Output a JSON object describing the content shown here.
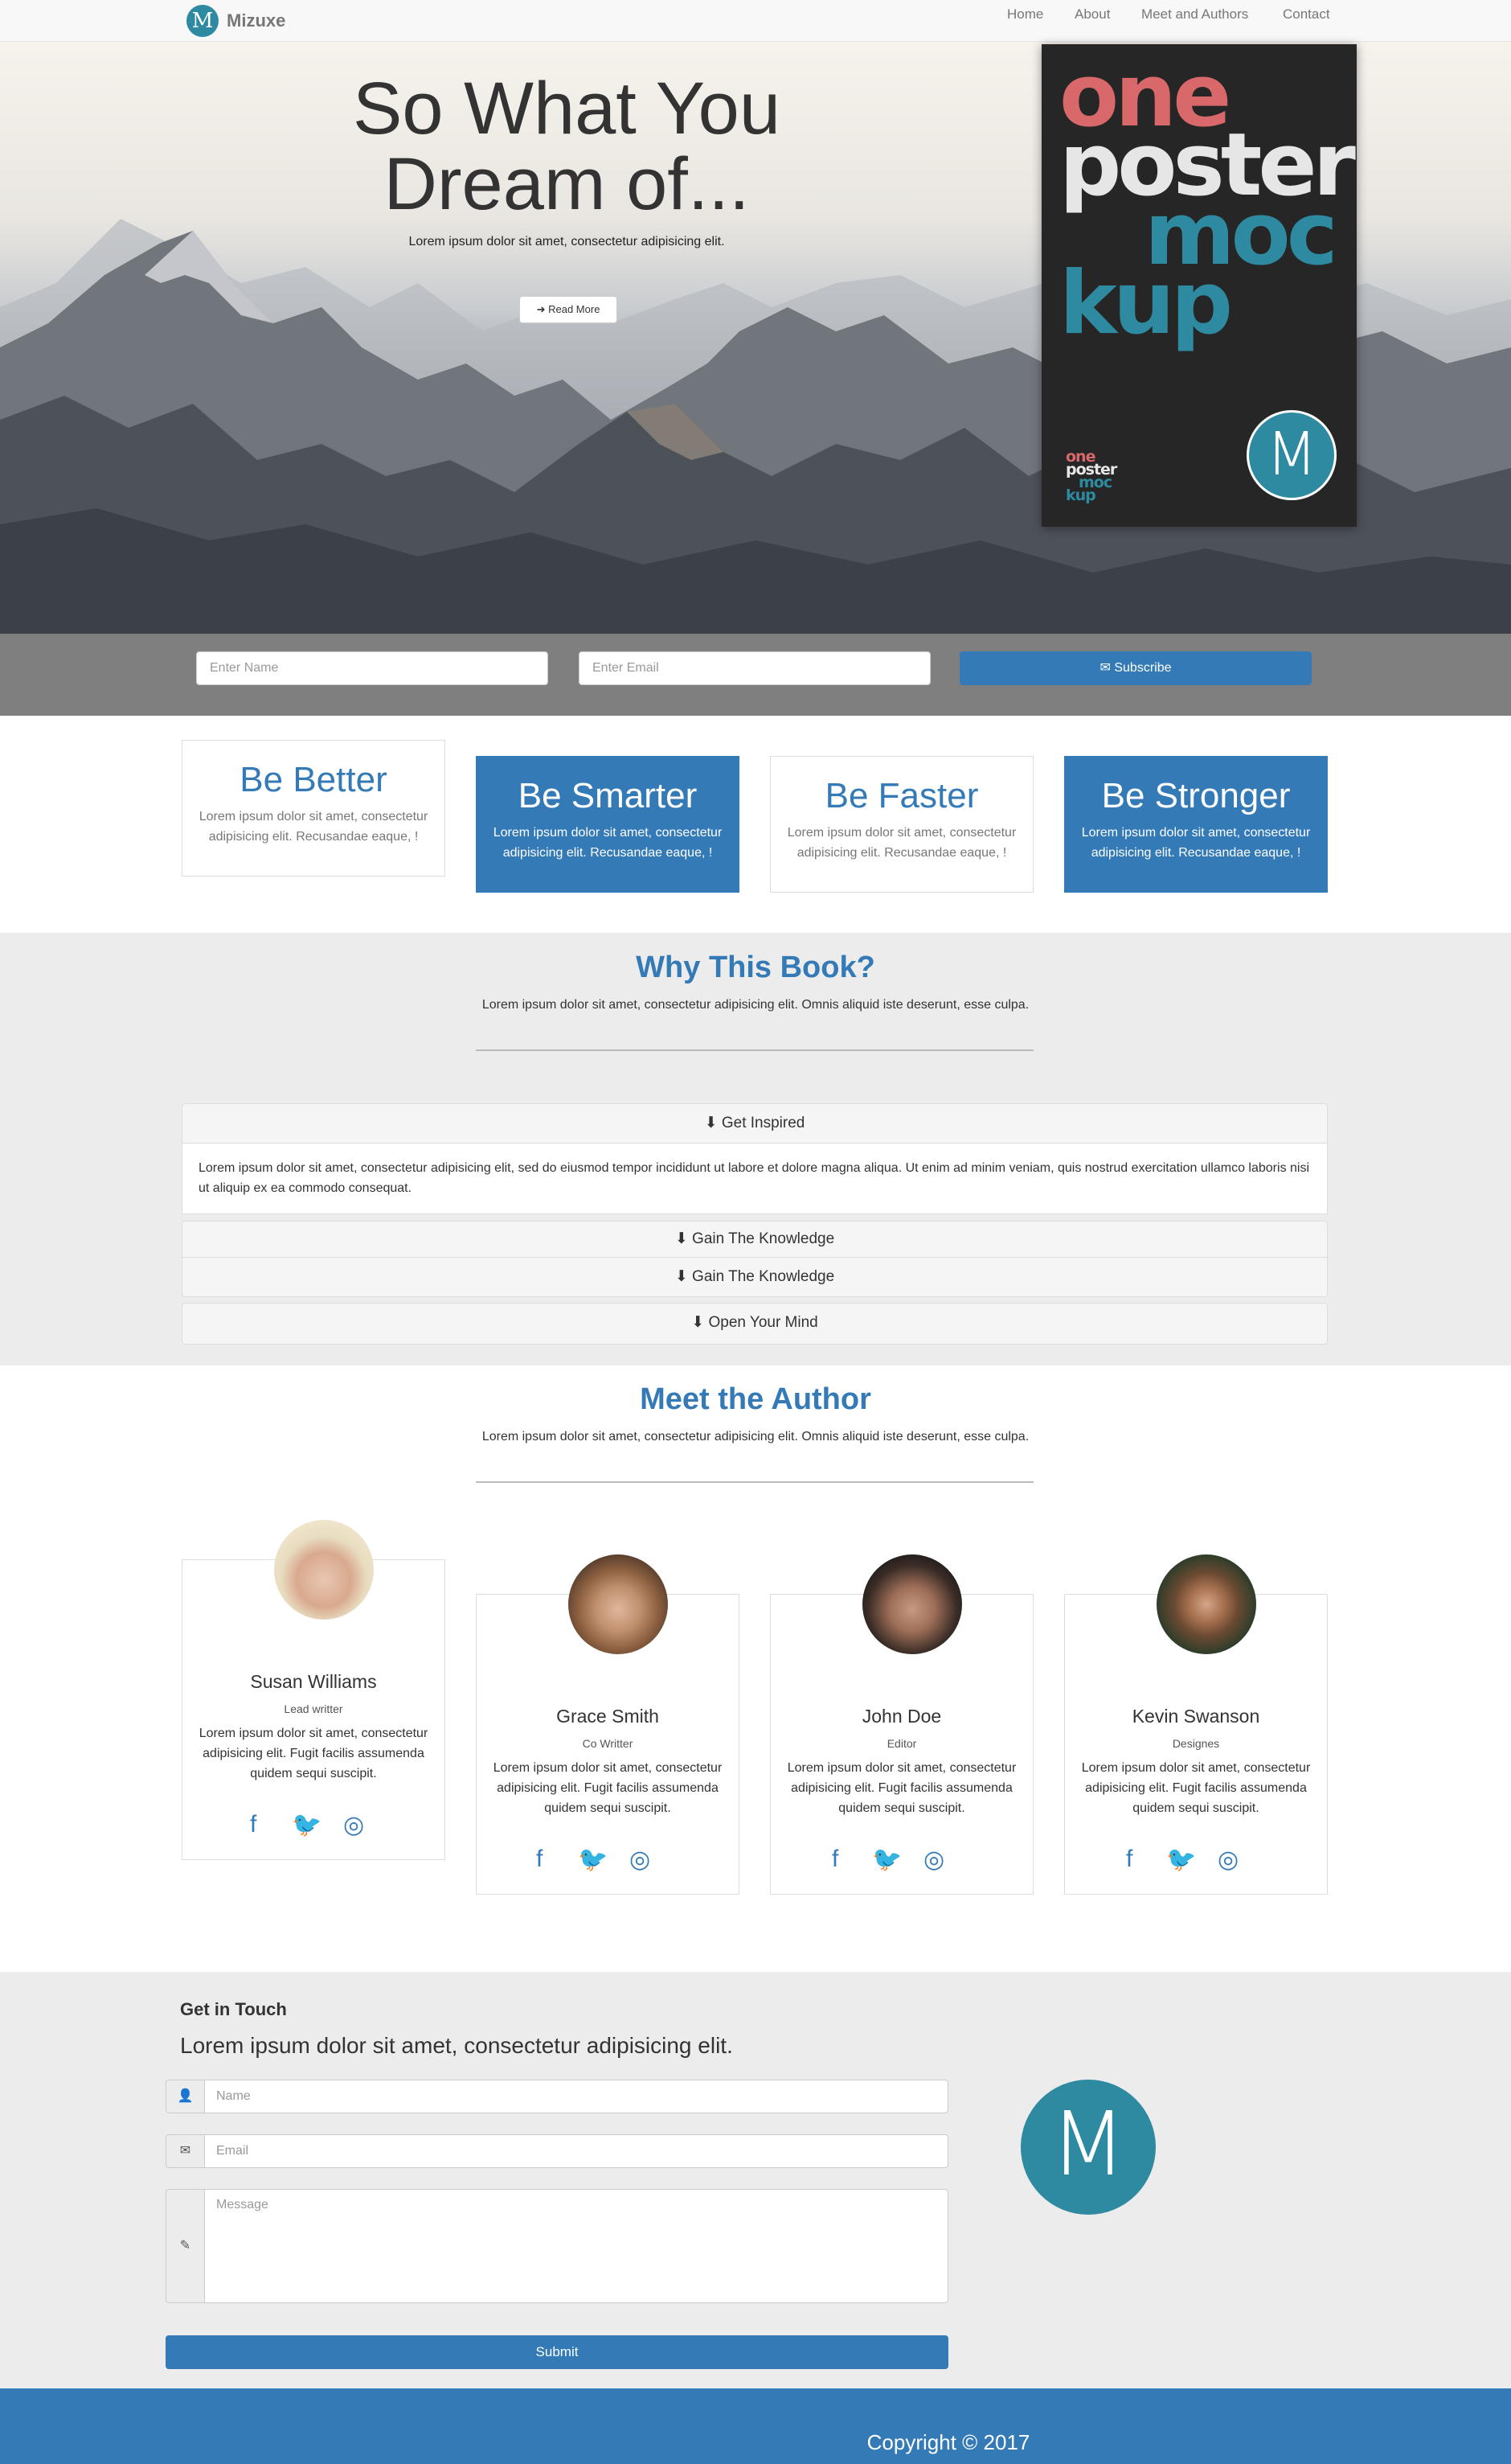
{
  "nav": {
    "brand_logo": "M",
    "brand": "Mizuxe",
    "links": [
      "Home",
      "About",
      "Meet and Authors",
      "Contact"
    ]
  },
  "hero": {
    "title": "So What You Dream of...",
    "subtitle": "Lorem ipsum dolor sit amet, consectetur adipisicing elit.",
    "button_icon": "arrow-right-icon",
    "button": "Read More"
  },
  "poster": {
    "words": [
      "one",
      "poster",
      "moc",
      "kup"
    ],
    "small_words": [
      "one",
      "poster",
      "moc",
      "kup"
    ],
    "logo": "M",
    "colors": {
      "one": "#d9686b",
      "poster": "#e6e6e6",
      "moc": "#2e8aa0",
      "kup": "#2e8aa0"
    }
  },
  "subscribe": {
    "name_placeholder": "Enter Name",
    "email_placeholder": "Enter Email",
    "button_icon": "envelope-icon",
    "button": "Subscribe"
  },
  "features": [
    {
      "title": "Be Better",
      "text": "Lorem ipsum dolor sit amet, consectetur adipisicing elit. Recusandae eaque, !",
      "style": "white"
    },
    {
      "title": "Be Smarter",
      "text": "Lorem ipsum dolor sit amet, consectetur adipisicing elit. Recusandae eaque, !",
      "style": "blue"
    },
    {
      "title": "Be Faster",
      "text": "Lorem ipsum dolor sit amet, consectetur adipisicing elit. Recusandae eaque, !",
      "style": "white"
    },
    {
      "title": "Be Stronger",
      "text": "Lorem ipsum dolor sit amet, consectetur adipisicing elit. Recusandae eaque, !",
      "style": "blue"
    }
  ],
  "why": {
    "title": "Why This Book?",
    "description": "Lorem ipsum dolor sit amet, consectetur adipisicing elit. Omnis aliquid iste deserunt, esse culpa.",
    "accordion": [
      {
        "label": "Get Inspired",
        "icon": "arrow-circle-down-icon",
        "expanded": true,
        "body": "Lorem ipsum dolor sit amet, consectetur adipisicing elit, sed do eiusmod tempor incididunt ut labore et dolore magna aliqua. Ut enim ad minim veniam, quis nostrud exercitation ullamco laboris nisi ut aliquip ex ea commodo consequat."
      },
      {
        "label": "Gain The Knowledge",
        "icon": "arrow-circle-down-icon",
        "expanded": false
      },
      {
        "label": "Gain The Knowledge",
        "icon": "arrow-circle-down-icon",
        "expanded": false
      },
      {
        "label": "Open Your Mind",
        "icon": "arrow-circle-down-icon",
        "expanded": false
      }
    ]
  },
  "authors": {
    "title": "Meet the Author",
    "description": "Lorem ipsum dolor sit amet, consectetur adipisicing elit. Omnis aliquid iste deserunt, esse culpa.",
    "cards": [
      {
        "name": "Susan Williams",
        "role": "Lead writter",
        "text": "Lorem ipsum dolor sit amet, consectetur adipisicing elit. Fugit facilis assumenda quidem sequi suscipit."
      },
      {
        "name": "Grace Smith",
        "role": "Co Writter",
        "text": "Lorem ipsum dolor sit amet, consectetur adipisicing elit. Fugit facilis assumenda quidem sequi suscipit."
      },
      {
        "name": "John Doe",
        "role": "Editor",
        "text": "Lorem ipsum dolor sit amet, consectetur adipisicing elit. Fugit facilis assumenda quidem sequi suscipit."
      },
      {
        "name": "Kevin Swanson",
        "role": "Designes",
        "text": "Lorem ipsum dolor sit amet, consectetur adipisicing elit. Fugit facilis assumenda quidem sequi suscipit."
      }
    ],
    "social_icons": [
      "facebook-icon",
      "twitter-icon",
      "instagram-icon"
    ]
  },
  "contact": {
    "heading": "Get in Touch",
    "lead": "Lorem ipsum dolor sit amet, consectetur adipisicing elit.",
    "name_placeholder": "Name",
    "email_placeholder": "Email",
    "message_placeholder": "Message",
    "submit": "Submit",
    "logo": "M"
  },
  "footer": {
    "copyright": "Copyright © 2017"
  },
  "colors": {
    "primary": "#337ab7",
    "brand_teal": "#2e8aa0",
    "section_gray": "#ececec",
    "subscribe_gray": "#7f7f7f"
  }
}
